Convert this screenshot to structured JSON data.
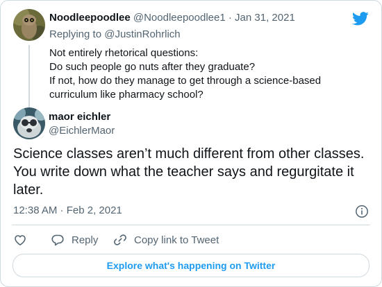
{
  "parent_tweet": {
    "display_name": "Noodleepoodlee",
    "handle": "@Noodleepoodlee1",
    "separator": "·",
    "date": "Jan 31, 2021",
    "replying_prefix": "Replying to",
    "replying_handle": "@JustinRohrlich",
    "text_lines": [
      "Not entirely rhetorical questions:",
      "Do such people go nuts after they graduate?",
      "If not, how do they manage to get through a science-based",
      "curriculum like pharmacy school?"
    ]
  },
  "main_tweet": {
    "display_name": "maor eichler",
    "handle": "@EichlerMaor",
    "text_lines": [
      "Science classes aren’t much different from other classes.",
      "You write down what the teacher says and regurgitate it",
      "later."
    ],
    "timestamp": "12:38 AM · Feb 2, 2021"
  },
  "actions": {
    "reply_label": "Reply",
    "copy_link_label": "Copy link to Tweet"
  },
  "explore_label": "Explore what's happening on Twitter",
  "colors": {
    "twitter_blue": "#1d9bf0",
    "text_primary": "#0f1419",
    "text_secondary": "#536471",
    "border": "#cfd9de"
  },
  "icons": {
    "brand": "twitter-bird-icon",
    "info": "info-icon",
    "like": "heart-icon",
    "reply": "reply-bubble-icon",
    "copy_link": "link-icon"
  }
}
